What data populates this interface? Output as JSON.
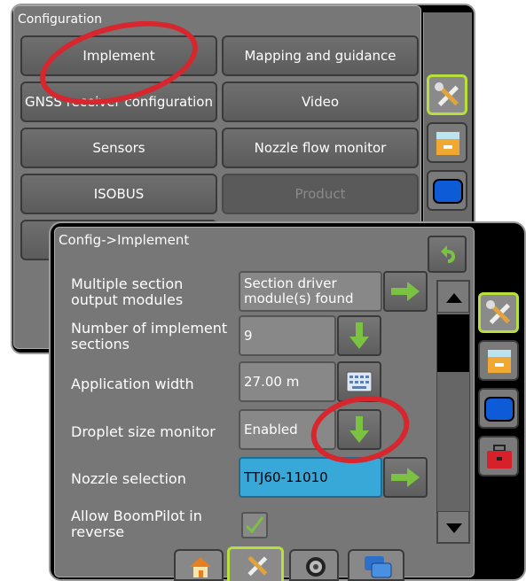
{
  "config_window": {
    "title": "Configuration",
    "buttons": [
      {
        "label": "Implement"
      },
      {
        "label": "Mapping and guidance"
      },
      {
        "label": "GNSS receiver configuration"
      },
      {
        "label": "Video"
      },
      {
        "label": "Sensors"
      },
      {
        "label": "Nozzle flow monitor"
      },
      {
        "label": "ISOBUS"
      },
      {
        "label": "Product"
      }
    ]
  },
  "implement_window": {
    "title": "Config->Implement",
    "rows": [
      {
        "label": "Multiple section output modules",
        "value": "Section driver module(s) found"
      },
      {
        "label": "Number of implement sections",
        "value": "9"
      },
      {
        "label": "Application width",
        "value": "27.00 m"
      },
      {
        "label": "Droplet size monitor",
        "value": "Enabled"
      },
      {
        "label": "Nozzle selection",
        "value": "TTJ60-11010"
      },
      {
        "label": "Allow BoomPilot in reverse",
        "value": "checked"
      }
    ]
  },
  "sidebar_icons": [
    "tools-icon",
    "console-icon",
    "display-icon",
    "toolbox-icon"
  ],
  "bottom_tabs": [
    "home-icon",
    "tools-icon",
    "gauge-icon",
    "windows-icon"
  ],
  "colors": {
    "accent_green": "#b7e03a",
    "highlight_blue": "#37a8d8",
    "annotation_red": "#d7262d"
  }
}
